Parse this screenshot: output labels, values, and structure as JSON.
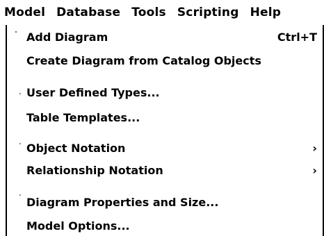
{
  "menubar": {
    "items": [
      {
        "label": "Model"
      },
      {
        "label": "Database"
      },
      {
        "label": "Tools"
      },
      {
        "label": "Scripting"
      },
      {
        "label": "Help"
      }
    ]
  },
  "dropdown": {
    "items": [
      {
        "label": "Add Diagram",
        "shortcut": "Ctrl+T"
      },
      {
        "label": "Create Diagram from Catalog Objects"
      },
      {
        "label": "User Defined Types..."
      },
      {
        "label": "Table Templates..."
      },
      {
        "label": "Object Notation",
        "submenu": "›"
      },
      {
        "label": "Relationship Notation",
        "submenu": "›"
      },
      {
        "label": "Diagram Properties and Size..."
      },
      {
        "label": "Model Options..."
      }
    ]
  }
}
